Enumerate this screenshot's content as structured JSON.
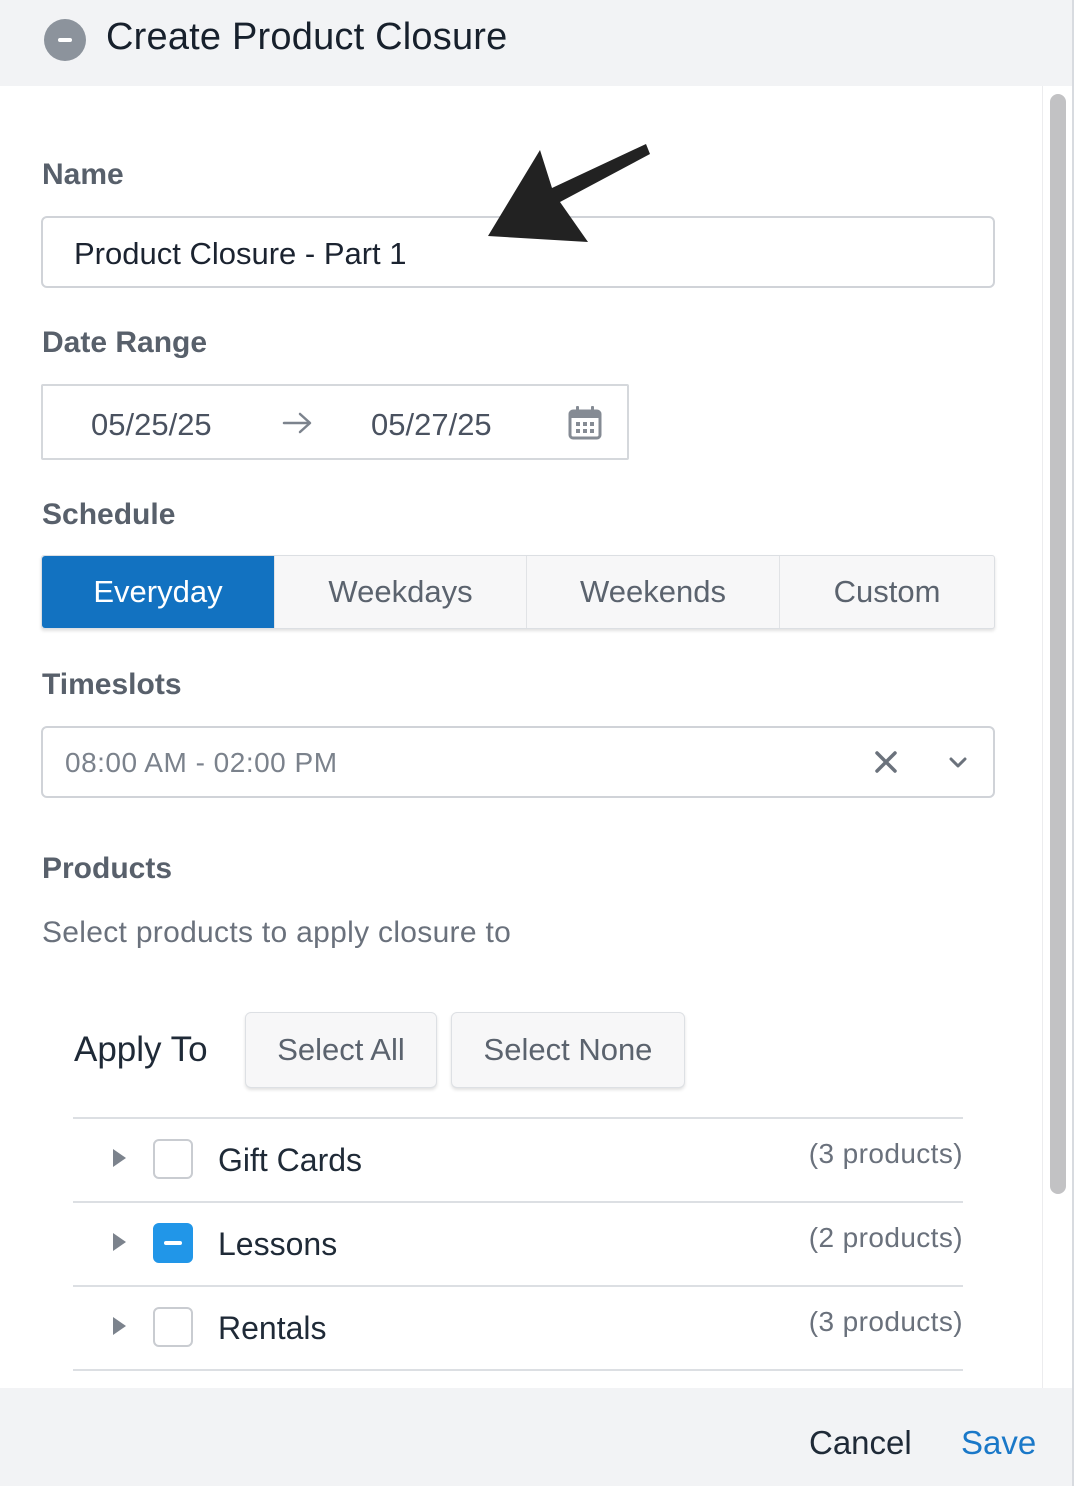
{
  "header": {
    "title": "Create Product Closure"
  },
  "form": {
    "name": {
      "label": "Name",
      "value": "Product Closure - Part 1"
    },
    "date_range": {
      "label": "Date Range",
      "start": "05/25/25",
      "end": "05/27/25"
    },
    "schedule": {
      "label": "Schedule",
      "options": [
        "Everyday",
        "Weekdays",
        "Weekends",
        "Custom"
      ],
      "selected": "Everyday"
    },
    "timeslots": {
      "label": "Timeslots",
      "value": "08:00 AM - 02:00 PM"
    },
    "products": {
      "label": "Products",
      "subtitle": "Select products to apply closure to",
      "apply_to": "Apply To",
      "select_all": "Select All",
      "select_none": "Select None",
      "groups": [
        {
          "name": "Gift Cards",
          "count": "(3 products)",
          "state": "unchecked"
        },
        {
          "name": "Lessons",
          "count": "(2 products)",
          "state": "indeterminate"
        },
        {
          "name": "Rentals",
          "count": "(3 products)",
          "state": "unchecked"
        }
      ]
    }
  },
  "footer": {
    "cancel": "Cancel",
    "save": "Save"
  },
  "colors": {
    "accent": "#1272c1",
    "checkbox_active": "#2196e8",
    "save_link": "#1a78c8"
  },
  "icons": [
    "collapse-icon",
    "arrow-right-icon",
    "calendar-icon",
    "clear-icon",
    "chevron-down-icon",
    "caret-right-icon",
    "annotation-arrow"
  ]
}
